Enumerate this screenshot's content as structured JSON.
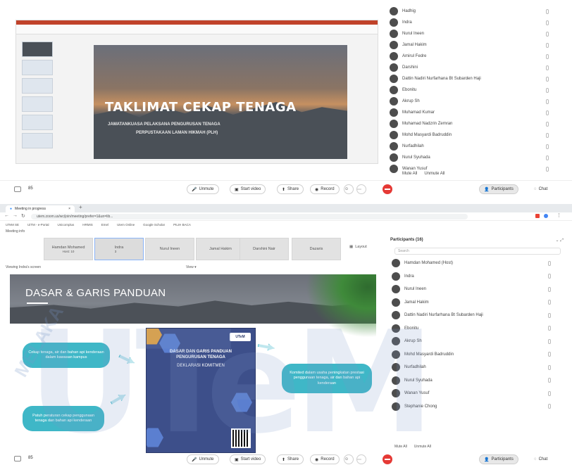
{
  "top": {
    "slide": {
      "title": "TAKLIMAT CEKAP TENAGA",
      "subtitle_1": "JAWATANKUASA PELAKSANA PENGURUSAN TENAGA",
      "subtitle_2": "PERPUSTAKAAN LAMAN HIKMAH (PLH)"
    },
    "participants": [
      "Hadhig",
      "Indra",
      "Nurul Ineen",
      "Jamal Hakim",
      "Amirul Fedre",
      "Darshini",
      "Dattin Nadiri Nurfarhana Bt Subarden Haji",
      "Ebonitu",
      "Akrup Sh",
      "Muhamad Kumar",
      "Muhamad Nadzrin Zemran",
      "Mohd Masyardi Badruddin",
      "Nurfadhilah",
      "Nurul Syuhada",
      "Wanan Yusuf"
    ],
    "bottom_left": [
      "Mute All",
      "Unmute All"
    ],
    "toolbar": {
      "unmute": "Unmute",
      "start_video": "Start video",
      "share": "Share",
      "record": "Record",
      "participants": "Participants",
      "chat": "Chat",
      "view_count": "85"
    }
  },
  "browser": {
    "tabs": [
      "Meeting in progress"
    ],
    "url": "utem.zoom.us/wc/join/meeting/prefer=1&un=lib...",
    "bookmarks": [
      "UTeM SE",
      "UiTM - e-Portal",
      "Unicornplus",
      "HRMIS",
      "Emel",
      "Utem Online",
      "Google Scholar",
      "PILIH BACA"
    ],
    "meeting_info": "Meeting info",
    "gallery": [
      {
        "name": "Hamdan Mohamed",
        "sub": "Host: 10"
      },
      {
        "name": "Indra",
        "sub": "3"
      },
      {
        "name": "Nurul Ineen",
        "sub": ""
      },
      {
        "name": "Jamal Hakim",
        "sub": ""
      },
      {
        "name": "Darshini Nair",
        "sub": ""
      },
      {
        "name": "Dazaris",
        "sub": ""
      }
    ],
    "layout_btn": "Layout",
    "share_label": "Viewing Indra's screen",
    "view_label": "View",
    "slide": {
      "title": "DASAR & GARIS PANDUAN",
      "poster_logo": "UTeM",
      "poster_t1": "DASAR DAN GARIS PANDUAN",
      "poster_t2": "PENGURUSAN TENAGA",
      "poster_t3": "DEKLARASI KOMITMEN",
      "bubble_1": "Cekap tenaga, air dan bahan api kenderaan dalam kawasan kampus",
      "bubble_2": "Patuh peraturan cekap penggunaan tenaga dan bahan api kenderaan",
      "bubble_3": "Komited dalam usaha peningkatan prestasi penggunaan tenaga, air dan bahan api kenderaan"
    },
    "participants_title": "Participants (16)",
    "search_placeholder": "Search",
    "participants": [
      "Hamdan Mohamed (Host)",
      "Indra",
      "Nurul Ineen",
      "Jamal Hakim",
      "Dattin Nadiri Nurfarhana Bt Subarden Haji",
      "Ebonitu",
      "Akrup Sh",
      "Mohd Masyardi Badruddin",
      "Nurfadhilah",
      "Nurul Syuhada",
      "Wanan Yusuf",
      "Stephanie Chong"
    ],
    "plist_bottom": [
      "Mute All",
      "Unmute All"
    ],
    "toolbar": {
      "unmute": "Unmute",
      "start_video": "Start video",
      "share": "Share",
      "record": "Record",
      "participants": "Participants",
      "chat": "Chat",
      "view_count": "85"
    }
  },
  "watermark": {
    "text": "UTeM",
    "arc": "MELAKA"
  }
}
